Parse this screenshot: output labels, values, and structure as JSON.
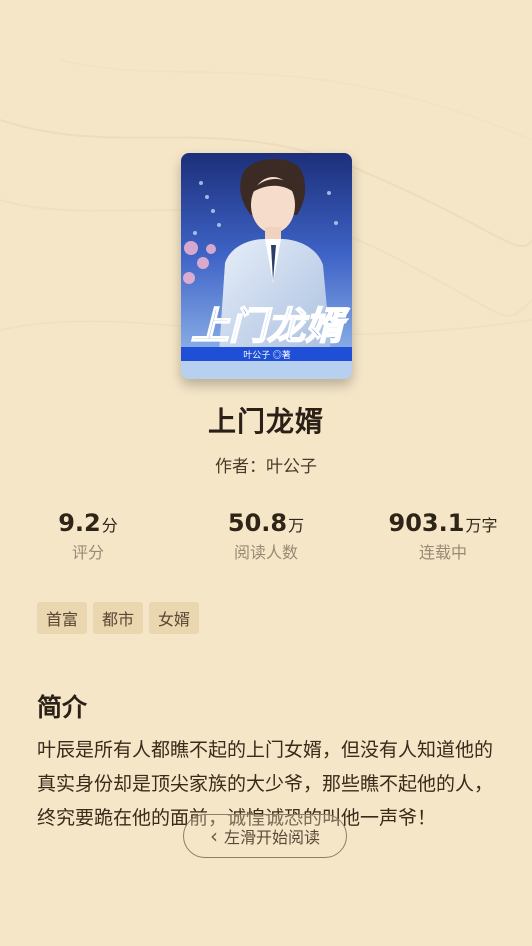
{
  "book": {
    "title": "上门龙婿",
    "author_line": "作者：叶公子",
    "cover_title": "上门龙婿",
    "cover_author": "叶公子 ◎著"
  },
  "stats": [
    {
      "value": "9.2",
      "unit": "分",
      "label": "评分"
    },
    {
      "value": "50.8",
      "unit": "万",
      "label": "阅读人数"
    },
    {
      "value": "903.1",
      "unit": "万字",
      "label": "连载中"
    }
  ],
  "tags": [
    "首富",
    "都市",
    "女婿"
  ],
  "intro": {
    "heading": "简介",
    "text": "叶辰是所有人都瞧不起的上门女婿，但没有人知道他的真实身份却是顶尖家族的大少爷，那些瞧不起他的人，终究要跪在他的面前，诚惶诚恐的叫他一声爷！"
  },
  "swipe_hint": "左滑开始阅读",
  "icons": {
    "swipe_left": "chevron-left-icon"
  },
  "colors": {
    "background": "#f5e6c8",
    "tag_bg": "#ead7b0",
    "cover_blue": "#1f4fd6"
  }
}
